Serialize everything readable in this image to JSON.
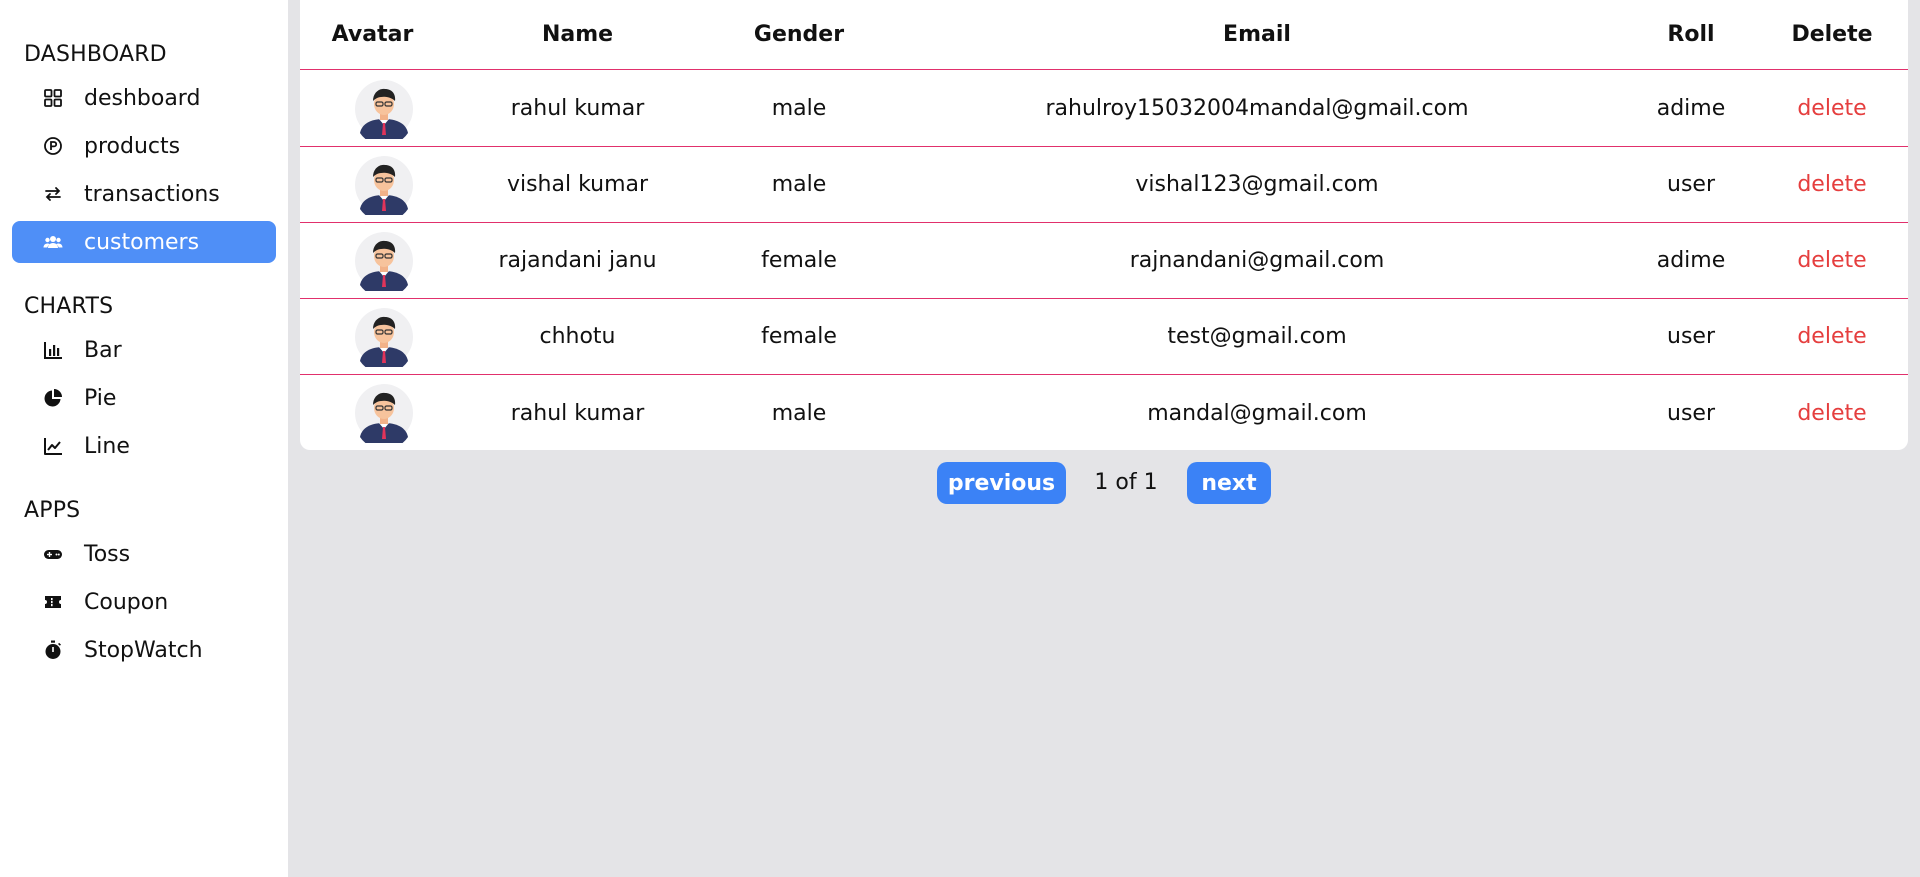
{
  "sidebar": {
    "dashboard_title": "DASHBOARD",
    "dashboard_items": [
      {
        "label": "deshboard",
        "icon": "grid-icon"
      },
      {
        "label": "products",
        "icon": "product-icon"
      },
      {
        "label": "transactions",
        "icon": "arrows-exchange-icon"
      },
      {
        "label": "customers",
        "icon": "users-icon",
        "active": true
      }
    ],
    "charts_title": "CHARTS",
    "charts_items": [
      {
        "label": "Bar",
        "icon": "bar-chart-icon"
      },
      {
        "label": "Pie",
        "icon": "pie-chart-icon"
      },
      {
        "label": "Line",
        "icon": "line-chart-icon"
      }
    ],
    "apps_title": "APPS",
    "apps_items": [
      {
        "label": "Toss",
        "icon": "gamepad-icon"
      },
      {
        "label": "Coupon",
        "icon": "ticket-icon"
      },
      {
        "label": "StopWatch",
        "icon": "stopwatch-icon"
      }
    ]
  },
  "table": {
    "headers": {
      "avatar": "Avatar",
      "name": "Name",
      "gender": "Gender",
      "email": "Email",
      "roll": "Roll",
      "delete": "Delete"
    },
    "rows": [
      {
        "name": "rahul kumar",
        "gender": "male",
        "email": "rahulroy15032004mandal@gmail.com",
        "roll": "adime",
        "action": "delete"
      },
      {
        "name": "vishal kumar",
        "gender": "male",
        "email": "vishal123@gmail.com",
        "roll": "user",
        "action": "delete"
      },
      {
        "name": "rajandani janu",
        "gender": "female",
        "email": "rajnandani@gmail.com",
        "roll": "adime",
        "action": "delete"
      },
      {
        "name": "chhotu",
        "gender": "female",
        "email": "test@gmail.com",
        "roll": "user",
        "action": "delete"
      },
      {
        "name": "rahul kumar",
        "gender": "male",
        "email": "mandal@gmail.com",
        "roll": "user",
        "action": "delete"
      }
    ]
  },
  "pagination": {
    "previous_label": "previous",
    "page_info": "1 of 1",
    "next_label": "next"
  },
  "colors": {
    "active_nav": "#4f8ff7",
    "button": "#3b82f6",
    "delete_text": "#e53e3e",
    "row_divider": "#e1306c",
    "background": "#e4e4e7"
  }
}
